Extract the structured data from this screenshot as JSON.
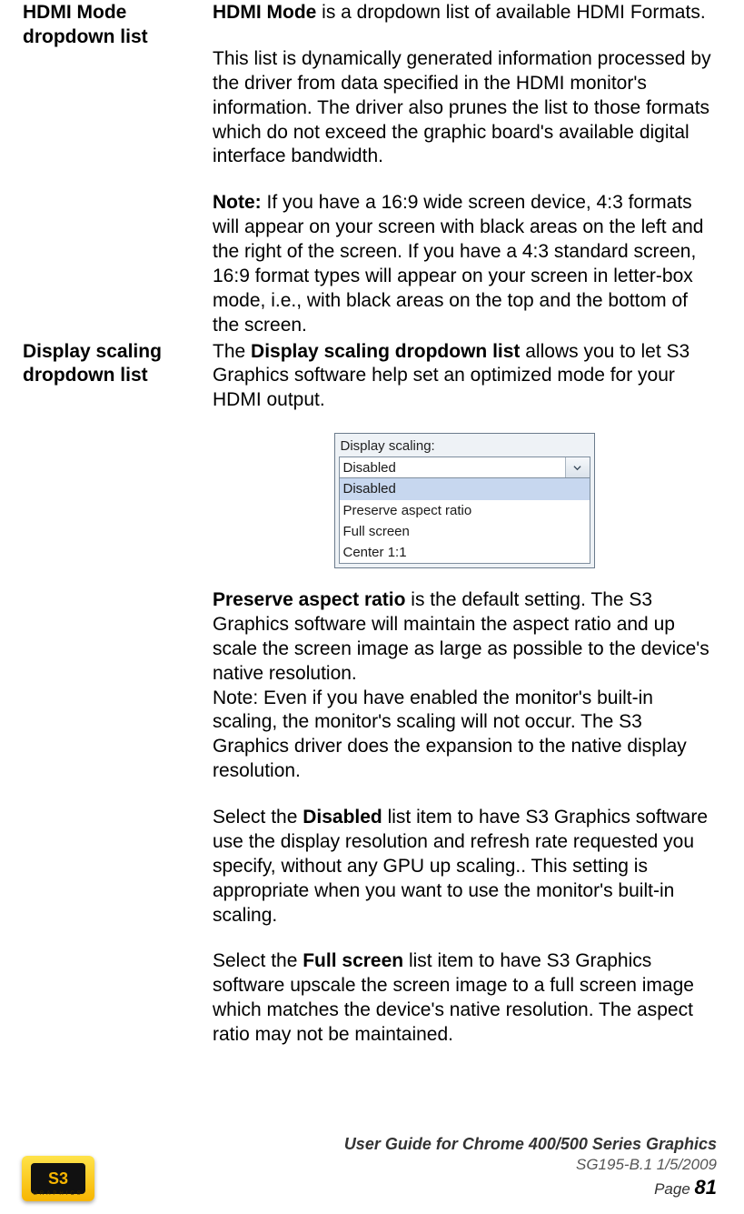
{
  "rows": [
    {
      "label": "HDMI Mode dropdown list",
      "body": {
        "p1": {
          "lead_bold": "HDMI Mode",
          "tail": " is a dropdown list of available HDMI Formats."
        },
        "p2": "This list is dynamically generated information processed by the driver from data specified in the HDMI monitor's information. The driver also prunes the list to those formats which do not exceed the graphic board's available digital interface bandwidth.",
        "p3": {
          "lead_bold": "Note:",
          "tail": " If you have a 16:9 wide screen device, 4:3 formats will appear on your screen with black areas on the left and the right of the screen. If you have a 4:3 standard screen, 16:9 format types will appear on your screen in letter-box mode, i.e., with black areas on the top and the bottom of the screen."
        }
      }
    },
    {
      "label": "Display scaling dropdown list",
      "body": {
        "p1": {
          "pre": "The ",
          "lead_bold": "Display scaling dropdown list",
          "tail": " allows you to let S3 Graphics software help set an optimized mode for your HDMI output."
        },
        "fig": {
          "caption": "Display scaling:",
          "selected": "Disabled",
          "items": [
            "Disabled",
            "Preserve aspect ratio",
            "Full screen",
            "Center 1:1"
          ]
        },
        "p2": {
          "lead_bold": "Preserve aspect ratio",
          "tail": " is the default setting. The S3 Graphics software will maintain the aspect ratio and up scale the screen image as large as possible to the device's native resolution."
        },
        "p3": "Note: Even if you have enabled the monitor's built-in scaling, the monitor's scaling will not occur. The S3 Graphics driver does the expansion to the native display resolution.",
        "p4": {
          "pre": "Select the ",
          "lead_bold": "Disabled",
          "tail": " list item to have S3 Graphics software use the display resolution and refresh rate requested you specify, without any GPU up scaling.. This setting is appropriate when you want to use the monitor's built-in scaling."
        },
        "p5": {
          "pre": "Select the ",
          "lead_bold": "Full screen",
          "tail": " list item to have S3 Graphics software upscale the screen image to a full screen image which matches the device's native resolution. The aspect ratio may not be maintained."
        }
      }
    }
  ],
  "logo": {
    "text": "S3",
    "sub": "GRAPHICS"
  },
  "footer": {
    "line1": "User Guide for Chrome 400/500 Series Graphics",
    "line2": "SG195-B.1   1/5/2009",
    "page_label": "Page ",
    "page_num": "81"
  }
}
